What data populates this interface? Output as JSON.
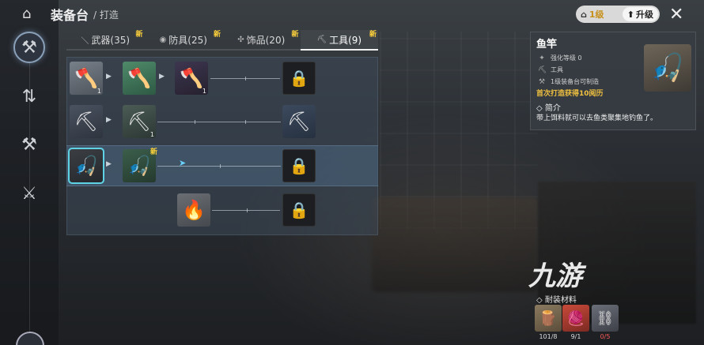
{
  "header": {
    "title": "装备台",
    "breadcrumb": "/ 打造"
  },
  "top_right": {
    "level_label": "1级",
    "upgrade_label": "升级"
  },
  "tabs": [
    {
      "label": "武器(35)",
      "new": "新"
    },
    {
      "label": "防具(25)",
      "new": "新"
    },
    {
      "label": "饰品(20)",
      "new": "新"
    },
    {
      "label": "工具(9)",
      "new": "新"
    }
  ],
  "rows": [
    {
      "counts": [
        "1",
        "",
        "1"
      ]
    },
    {
      "counts": [
        "",
        "1"
      ]
    },
    {
      "new_badge": "新"
    },
    {}
  ],
  "detail": {
    "name": "鱼竿",
    "enhance": "强化等级 0",
    "type": "工具",
    "req": "1级装备台可制造",
    "first_reward": "首次打造获得10阅历",
    "intro_title": "◇ 简介",
    "intro_text": "带上饵料就可以去鱼类聚集地钓鱼了。"
  },
  "materials": {
    "title": "◇ 耐装材料",
    "items": [
      {
        "count": "101/8"
      },
      {
        "count": "9/1"
      },
      {
        "count": "0/5"
      }
    ]
  },
  "watermark": "九游"
}
